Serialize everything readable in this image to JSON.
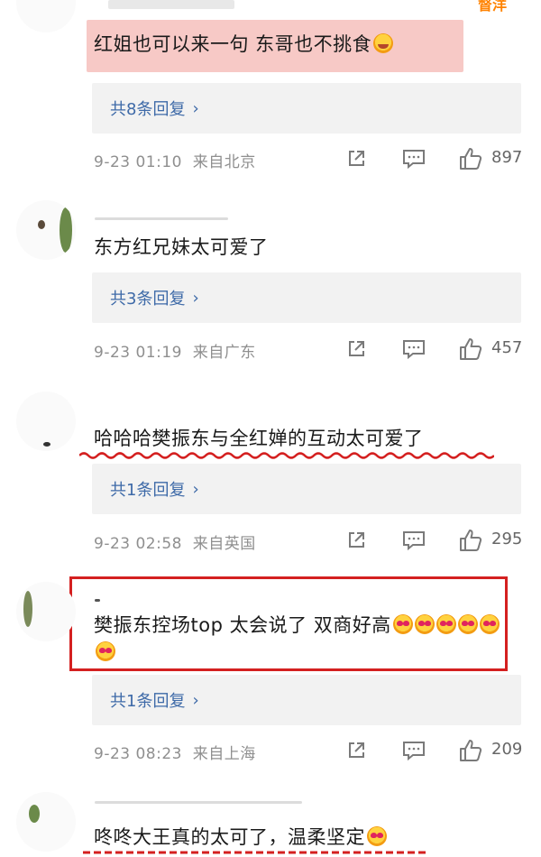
{
  "top": {
    "author_badge": "督洋"
  },
  "comments": [
    {
      "text": "红姐也可以来一句 东哥也不挑食",
      "replies": "共8条回复",
      "time": "9-23 01:10",
      "from": "来自北京",
      "likes": "897"
    },
    {
      "text": "东方红兄妹太可爱了",
      "replies": "共3条回复",
      "time": "9-23 01:19",
      "from": "来自广东",
      "likes": "457"
    },
    {
      "text": "哈哈哈樊振东与全红婵的互动太可爱了",
      "replies": "共1条回复",
      "time": "9-23 02:58",
      "from": "来自英国",
      "likes": "295"
    },
    {
      "text": "樊振东控场top  太会说了 双商好高",
      "replies": "共1条回复",
      "time": "9-23 08:23",
      "from": "来自上海",
      "likes": "209"
    },
    {
      "text": "咚咚大王真的太可了，温柔坚定"
    }
  ],
  "icons": [
    "share-icon",
    "comment-icon",
    "like-icon",
    "chevron-right-icon",
    "emoji-icon"
  ],
  "colors": {
    "link": "#3e6aa8",
    "meta": "#8f8f8f",
    "reply_bg": "#f2f2f2",
    "mark_red": "#d42020",
    "highlight": "#f7c9c6"
  }
}
